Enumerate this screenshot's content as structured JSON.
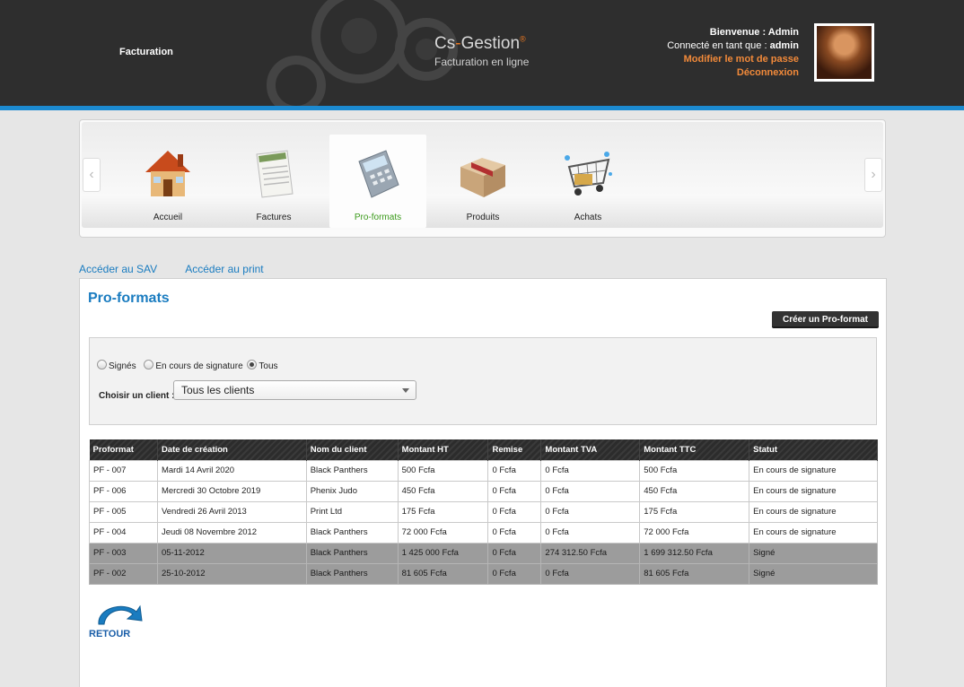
{
  "header": {
    "section_title": "Facturation",
    "logo_title_a": "Cs",
    "logo_title_dash": "-",
    "logo_title_b": "Gestion",
    "logo_reg": "®",
    "logo_subtitle": "Facturation en ligne",
    "welcome": "Bienvenue : Admin",
    "connected_as_label": "Connecté en tant que : ",
    "connected_as_user": "admin",
    "change_password": "Modifier le mot de passe",
    "logout": "Déconnexion"
  },
  "nav": {
    "items": [
      {
        "label": "Accueil",
        "icon": "house-icon"
      },
      {
        "label": "Factures",
        "icon": "invoice-icon"
      },
      {
        "label": "Pro-formats",
        "icon": "calculator-icon",
        "active": true
      },
      {
        "label": "Produits",
        "icon": "box-icon"
      },
      {
        "label": "Achats",
        "icon": "cart-icon"
      }
    ],
    "prev_arrow": "‹",
    "next_arrow": "›"
  },
  "links": {
    "sav": "Accéder au SAV",
    "print": "Accéder au print"
  },
  "main": {
    "title": "Pro-formats",
    "create_button": "Créer un Pro-format",
    "filters": {
      "radio_signed": "Signés",
      "radio_in_progress": "En cours de signature",
      "radio_all": "Tous",
      "selected": "Tous",
      "client_label": "Choisir un client :",
      "client_value": "Tous les clients"
    },
    "table": {
      "headers": [
        "Proformat",
        "Date de création",
        "Nom du client",
        "Montant HT",
        "Remise",
        "Montant TVA",
        "Montant TTC",
        "Statut"
      ],
      "rows": [
        [
          "PF - 007",
          "Mardi 14 Avril 2020",
          "Black Panthers",
          "500 Fcfa",
          "0 Fcfa",
          "0 Fcfa",
          "500 Fcfa",
          "En cours de signature"
        ],
        [
          "PF - 006",
          "Mercredi 30 Octobre 2019",
          "Phenix Judo",
          "450 Fcfa",
          "0 Fcfa",
          "0 Fcfa",
          "450 Fcfa",
          "En cours de signature"
        ],
        [
          "PF - 005",
          "Vendredi 26 Avril 2013",
          "Print Ltd",
          "175 Fcfa",
          "0 Fcfa",
          "0 Fcfa",
          "175 Fcfa",
          "En cours de signature"
        ],
        [
          "PF - 004",
          "Jeudi 08 Novembre 2012",
          "Black Panthers",
          "72 000 Fcfa",
          "0 Fcfa",
          "0 Fcfa",
          "72 000 Fcfa",
          "En cours de signature"
        ],
        [
          "PF - 003",
          "05-11-2012",
          "Black Panthers",
          "1 425 000 Fcfa",
          "0 Fcfa",
          "274 312.50 Fcfa",
          "1 699 312.50 Fcfa",
          "Signé"
        ],
        [
          "PF - 002",
          "25-10-2012",
          "Black Panthers",
          "81 605 Fcfa",
          "0 Fcfa",
          "0 Fcfa",
          "81 605 Fcfa",
          "Signé"
        ]
      ]
    },
    "back_button": "RETOUR"
  },
  "colors": {
    "accent": "#1a7cc0",
    "header_bg": "#2e2e2e",
    "orange": "#f28a3a",
    "signed_row": "#9c9c9c"
  }
}
